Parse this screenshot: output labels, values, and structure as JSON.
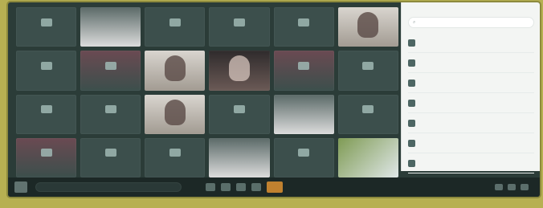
{
  "window": {
    "title": ""
  },
  "grid": {
    "tiles": [
      {
        "label": ""
      },
      {
        "label": ""
      },
      {
        "label": ""
      },
      {
        "label": ""
      },
      {
        "label": ""
      },
      {
        "label": ""
      },
      {
        "label": ""
      },
      {
        "label": ""
      },
      {
        "label": ""
      },
      {
        "label": ""
      },
      {
        "label": ""
      },
      {
        "label": ""
      },
      {
        "label": ""
      },
      {
        "label": ""
      },
      {
        "label": ""
      },
      {
        "label": ""
      },
      {
        "label": ""
      },
      {
        "label": ""
      },
      {
        "label": ""
      },
      {
        "label": ""
      },
      {
        "label": ""
      },
      {
        "label": ""
      },
      {
        "label": ""
      },
      {
        "label": ""
      }
    ]
  },
  "panel": {
    "header": "",
    "search_placeholder": "",
    "items": [
      {
        "label": "",
        "meta": ""
      },
      {
        "label": "",
        "meta": ""
      },
      {
        "label": "",
        "meta": ""
      },
      {
        "label": "",
        "meta": ""
      },
      {
        "label": "",
        "meta": ""
      },
      {
        "label": "",
        "meta": ""
      },
      {
        "label": "",
        "meta": ""
      }
    ]
  },
  "taskbar": {
    "search_placeholder": "",
    "clock": ""
  }
}
